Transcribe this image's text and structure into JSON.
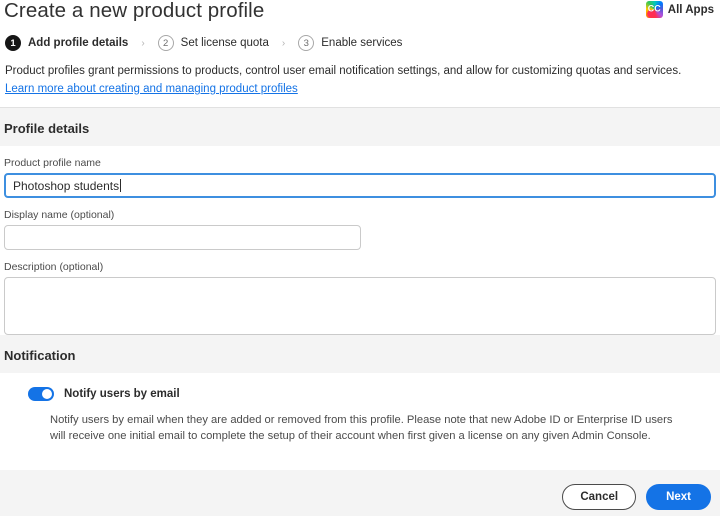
{
  "header": {
    "title": "Create a new product profile",
    "all_apps_label": "All Apps",
    "cc_glyph": "CC"
  },
  "steps": [
    {
      "number": "1",
      "label": "Add profile details",
      "state": "active"
    },
    {
      "number": "2",
      "label": "Set license quota",
      "state": "inactive"
    },
    {
      "number": "3",
      "label": "Enable services",
      "state": "inactive"
    }
  ],
  "step_separator": "›",
  "intro": {
    "text": "Product profiles grant permissions to products, control user email notification settings, and allow for customizing quotas and services.",
    "link_text": "Learn more about creating and managing product profiles"
  },
  "profile_details": {
    "heading": "Profile details",
    "fields": [
      {
        "label": "Product profile name",
        "value": "Photoshop students",
        "placeholder": ""
      },
      {
        "label": "Display name (optional)",
        "value": "",
        "placeholder": ""
      },
      {
        "label": "Description (optional)",
        "value": "",
        "placeholder": ""
      }
    ]
  },
  "notification": {
    "heading": "Notification",
    "toggle_label": "Notify users by email",
    "toggle_state": "on",
    "body": "Notify users by email when they are added or removed from this profile. Please note that new Adobe ID or Enterprise ID users will receive one initial email to complete the setup of their account when first given a license on any given Admin Console."
  },
  "footer": {
    "cancel_label": "Cancel",
    "next_label": "Next"
  },
  "colors": {
    "accent_blue": "#1473e6",
    "focus_blue": "#3d8fe0",
    "page_background": "#f4f4f4",
    "card_background": "#ffffff",
    "text_primary": "#2c2c2c",
    "text_secondary": "#4b4b4b",
    "step_active": "#161616"
  }
}
